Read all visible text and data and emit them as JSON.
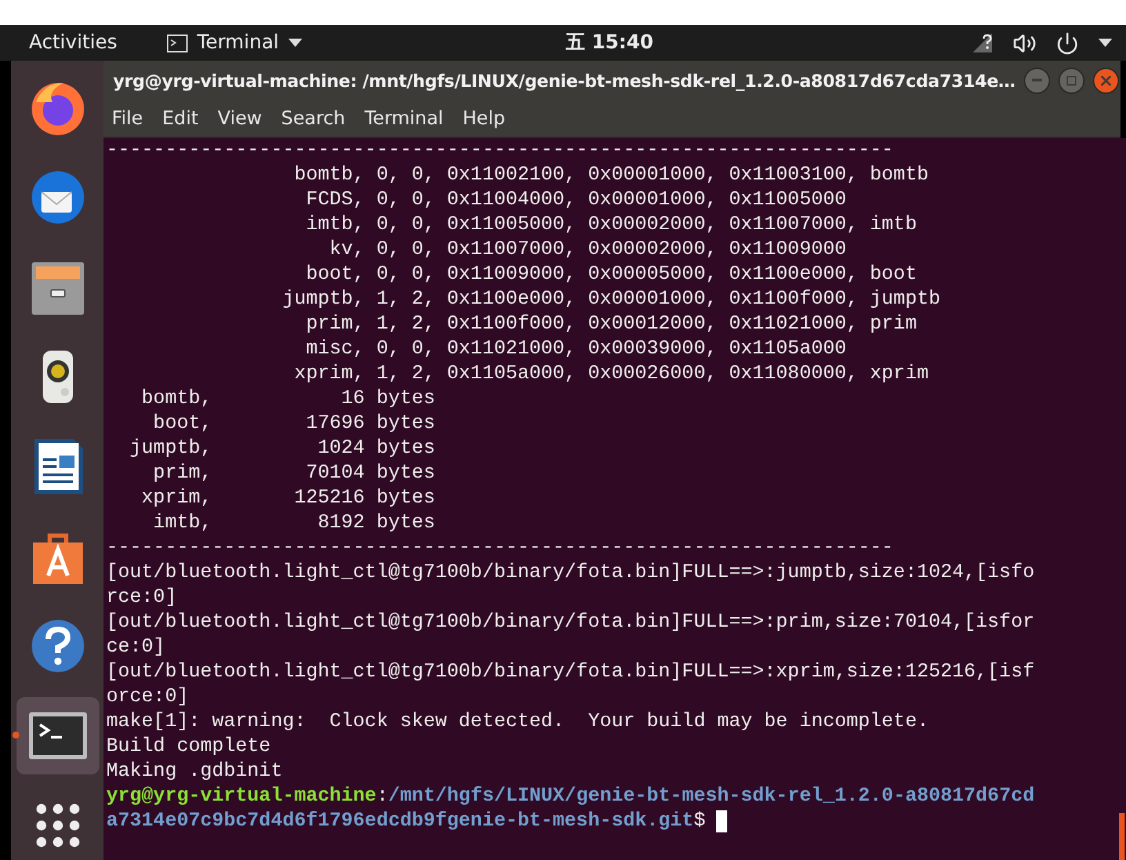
{
  "top_bar": {
    "activities": "Activities",
    "app_menu": "Terminal",
    "clock": "五 15:40"
  },
  "dock": {
    "items": [
      {
        "kind": "firefox",
        "selected": false
      },
      {
        "kind": "thunderbird",
        "selected": false
      },
      {
        "kind": "files",
        "selected": false
      },
      {
        "kind": "rhythmbox",
        "selected": false
      },
      {
        "kind": "writer",
        "selected": false
      },
      {
        "kind": "software",
        "selected": false
      },
      {
        "kind": "help",
        "selected": false
      },
      {
        "kind": "terminal",
        "selected": true
      },
      {
        "kind": "apps",
        "selected": false
      }
    ]
  },
  "window": {
    "title": "yrg@yrg-virtual-machine: /mnt/hgfs/LINUX/genie-bt-mesh-sdk-rel_1.2.0-a80817d67cda7314e…",
    "menu": [
      "File",
      "Edit",
      "View",
      "Search",
      "Terminal",
      "Help"
    ]
  },
  "terminal": {
    "lines": [
      [
        {
          "kind": "plain",
          "text": "-------------------------------------------------------------------"
        }
      ],
      [
        {
          "kind": "plain",
          "text": "                bomtb, 0, 0, 0x11002100, 0x00001000, 0x11003100, bomtb"
        }
      ],
      [
        {
          "kind": "plain",
          "text": "                 FCDS, 0, 0, 0x11004000, 0x00001000, 0x11005000"
        }
      ],
      [
        {
          "kind": "plain",
          "text": "                 imtb, 0, 0, 0x11005000, 0x00002000, 0x11007000, imtb"
        }
      ],
      [
        {
          "kind": "plain",
          "text": "                   kv, 0, 0, 0x11007000, 0x00002000, 0x11009000"
        }
      ],
      [
        {
          "kind": "plain",
          "text": "                 boot, 0, 0, 0x11009000, 0x00005000, 0x1100e000, boot"
        }
      ],
      [
        {
          "kind": "plain",
          "text": "               jumptb, 1, 2, 0x1100e000, 0x00001000, 0x1100f000, jumptb"
        }
      ],
      [
        {
          "kind": "plain",
          "text": "                 prim, 1, 2, 0x1100f000, 0x00012000, 0x11021000, prim"
        }
      ],
      [
        {
          "kind": "plain",
          "text": "                 misc, 0, 0, 0x11021000, 0x00039000, 0x1105a000"
        }
      ],
      [
        {
          "kind": "plain",
          "text": "                xprim, 1, 2, 0x1105a000, 0x00026000, 0x11080000, xprim"
        }
      ],
      [
        {
          "kind": "plain",
          "text": "   bomtb,           16 bytes"
        }
      ],
      [
        {
          "kind": "plain",
          "text": "    boot,        17696 bytes"
        }
      ],
      [
        {
          "kind": "plain",
          "text": "  jumptb,         1024 bytes"
        }
      ],
      [
        {
          "kind": "plain",
          "text": "    prim,        70104 bytes"
        }
      ],
      [
        {
          "kind": "plain",
          "text": "   xprim,       125216 bytes"
        }
      ],
      [
        {
          "kind": "plain",
          "text": "    imtb,         8192 bytes"
        }
      ],
      [
        {
          "kind": "plain",
          "text": "-------------------------------------------------------------------"
        }
      ],
      [
        {
          "kind": "plain",
          "text": "[out/bluetooth.light_ctl@tg7100b/binary/fota.bin]FULL==>:jumptb,size:1024,[isfo"
        }
      ],
      [
        {
          "kind": "plain",
          "text": "rce:0]"
        }
      ],
      [
        {
          "kind": "plain",
          "text": "[out/bluetooth.light_ctl@tg7100b/binary/fota.bin]FULL==>:prim,size:70104,[isfor"
        }
      ],
      [
        {
          "kind": "plain",
          "text": "ce:0]"
        }
      ],
      [
        {
          "kind": "plain",
          "text": "[out/bluetooth.light_ctl@tg7100b/binary/fota.bin]FULL==>:xprim,size:125216,[isf"
        }
      ],
      [
        {
          "kind": "plain",
          "text": "orce:0]"
        }
      ],
      [
        {
          "kind": "plain",
          "text": "make[1]: warning:  Clock skew detected.  Your build may be incomplete."
        }
      ],
      [
        {
          "kind": "plain",
          "text": "Build complete"
        }
      ],
      [
        {
          "kind": "plain",
          "text": "Making .gdbinit"
        }
      ],
      [
        {
          "kind": "user",
          "text": "yrg@yrg-virtual-machine"
        },
        {
          "kind": "plain",
          "text": ":"
        },
        {
          "kind": "path",
          "text": "/mnt/hgfs/LINUX/genie-bt-mesh-sdk-rel_1.2.0-a80817d67cd"
        }
      ],
      [
        {
          "kind": "path",
          "text": "a7314e07c9bc7d4d6f1796edcdb9fgenie-bt-mesh-sdk.git"
        },
        {
          "kind": "plain",
          "text": "$"
        }
      ]
    ]
  }
}
